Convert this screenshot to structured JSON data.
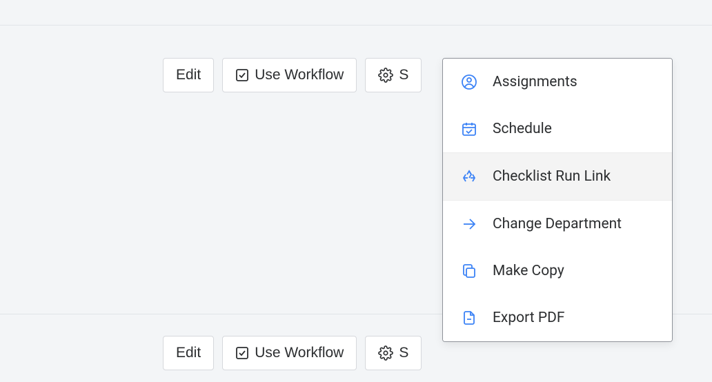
{
  "toolbars": [
    {
      "edit": "Edit",
      "use_workflow": "Use Workflow",
      "settings": "S"
    },
    {
      "edit": "Edit",
      "use_workflow": "Use Workflow",
      "settings": "S"
    }
  ],
  "menu": {
    "assignments": "Assignments",
    "schedule": "Schedule",
    "checklist_run_link": "Checklist Run Link",
    "change_department": "Change Department",
    "make_copy": "Make Copy",
    "export_pdf": "Export PDF"
  }
}
